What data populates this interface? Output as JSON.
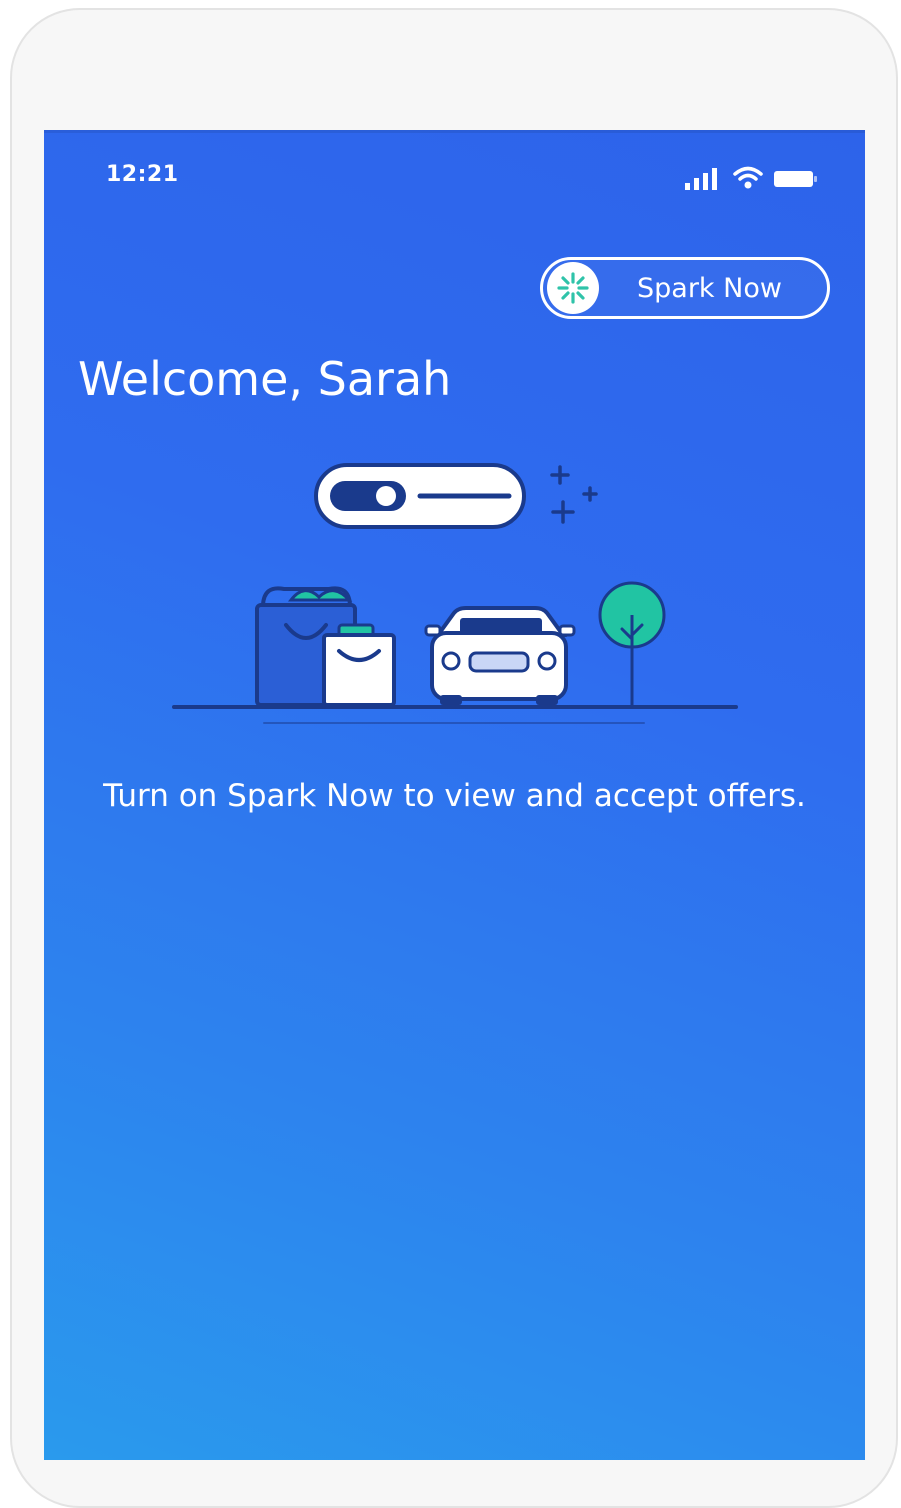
{
  "status_bar": {
    "time": "12:21",
    "icons": [
      "signal-icon",
      "wifi-icon",
      "battery-icon"
    ]
  },
  "header": {
    "spark_now_label": "Spark Now",
    "spark_logo_icon": "spark-logo-icon"
  },
  "main": {
    "welcome": "Welcome, Sarah",
    "hint": "Turn on Spark Now to view and accept offers."
  },
  "colors": {
    "screen_gradient_top": "#2d63ea",
    "screen_gradient_bottom": "#2a9aed",
    "illustration_dark": "#1a3a8c",
    "tree": "#21c4a3",
    "logo_accent": "#2fc3a9"
  }
}
